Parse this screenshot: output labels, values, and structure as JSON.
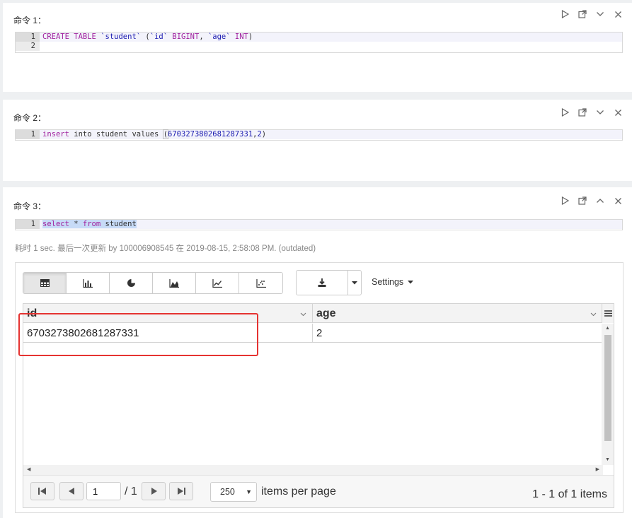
{
  "paragraphs": [
    {
      "title": "命令 1：",
      "lines": [
        {
          "num": "1",
          "tokens": [
            {
              "t": "CREATE TABLE ",
              "c": "kw"
            },
            {
              "t": "`student`",
              "c": "str"
            },
            {
              "t": " (",
              "c": ""
            },
            {
              "t": "`id`",
              "c": "str"
            },
            {
              "t": " BIGINT",
              "c": "kw"
            },
            {
              "t": ", ",
              "c": ""
            },
            {
              "t": "`age`",
              "c": "str"
            },
            {
              "t": " INT",
              "c": "kw"
            },
            {
              "t": ")",
              "c": ""
            }
          ]
        },
        {
          "num": "2",
          "tokens": []
        }
      ]
    },
    {
      "title": "命令 2：",
      "lines": [
        {
          "num": "1",
          "tokens": [
            {
              "t": "insert",
              "c": "kw"
            },
            {
              "t": " into student values ",
              "c": ""
            },
            {
              "t": "(",
              "c": "paren-box"
            },
            {
              "t": "6703273802681287331",
              "c": "num"
            },
            {
              "t": ",",
              "c": ""
            },
            {
              "t": "2",
              "c": "num"
            },
            {
              "t": ")",
              "c": ""
            }
          ]
        }
      ]
    },
    {
      "title": "命令 3：",
      "lines": [
        {
          "num": "1",
          "tokens": [
            {
              "t": "select",
              "c": "kw sel"
            },
            {
              "t": " * ",
              "c": "sel"
            },
            {
              "t": "from",
              "c": "kw sel"
            },
            {
              "t": " student",
              "c": "sel"
            }
          ]
        }
      ]
    }
  ],
  "result": {
    "meta": "耗时 1 sec. 最后一次更新 by 100006908545 在 2019-08-15, 2:58:08 PM. (outdated)",
    "settings_label": "Settings",
    "columns": [
      "id",
      "age"
    ],
    "rows": [
      [
        "6703273802681287331",
        "2"
      ]
    ],
    "pager": {
      "current_page": "1",
      "of_pages": "/ 1",
      "page_size": "250",
      "page_size_label": "items per page",
      "count_text": "1 - 1 of 1 items"
    }
  },
  "colors": {
    "annotation": "#e53331",
    "keyword": "#a0219e",
    "string": "#1b1bb0",
    "selection": "#c7dbf7"
  }
}
